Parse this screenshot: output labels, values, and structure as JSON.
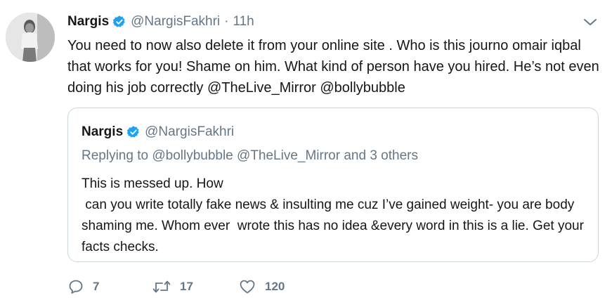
{
  "author": {
    "name": "Nargis",
    "handle": "@NargisFakhri",
    "separator": "·",
    "time": "11h"
  },
  "tweet": {
    "text": "You need to now also delete it from your online site . Who is this journo omair iqbal that works for you! Shame on him. What kind of person have you hired. He’s not even doing his job correctly @TheLive_Mirror @bollybubble"
  },
  "quoted": {
    "name": "Nargis",
    "handle": "@NargisFakhri",
    "replying_to": "Replying to @bollybubble @TheLive_Mirror and 3 others",
    "text": "This is messed up. How\n can you write totally fake news & insulting me cuz I’ve gained weight- you are body shaming me. Whom ever  wrote this has no idea &every word in this is a lie. Get your facts checks."
  },
  "actions": {
    "replies": "7",
    "retweets": "17",
    "likes": "120"
  },
  "icons": {
    "verified": "verified-badge-icon",
    "caret": "chevron-down-icon",
    "reply": "reply-icon",
    "retweet": "retweet-icon",
    "like": "heart-icon"
  },
  "colors": {
    "verified": "#1da1f2",
    "secondary_text": "#657786",
    "border": "#ccd6dd"
  }
}
